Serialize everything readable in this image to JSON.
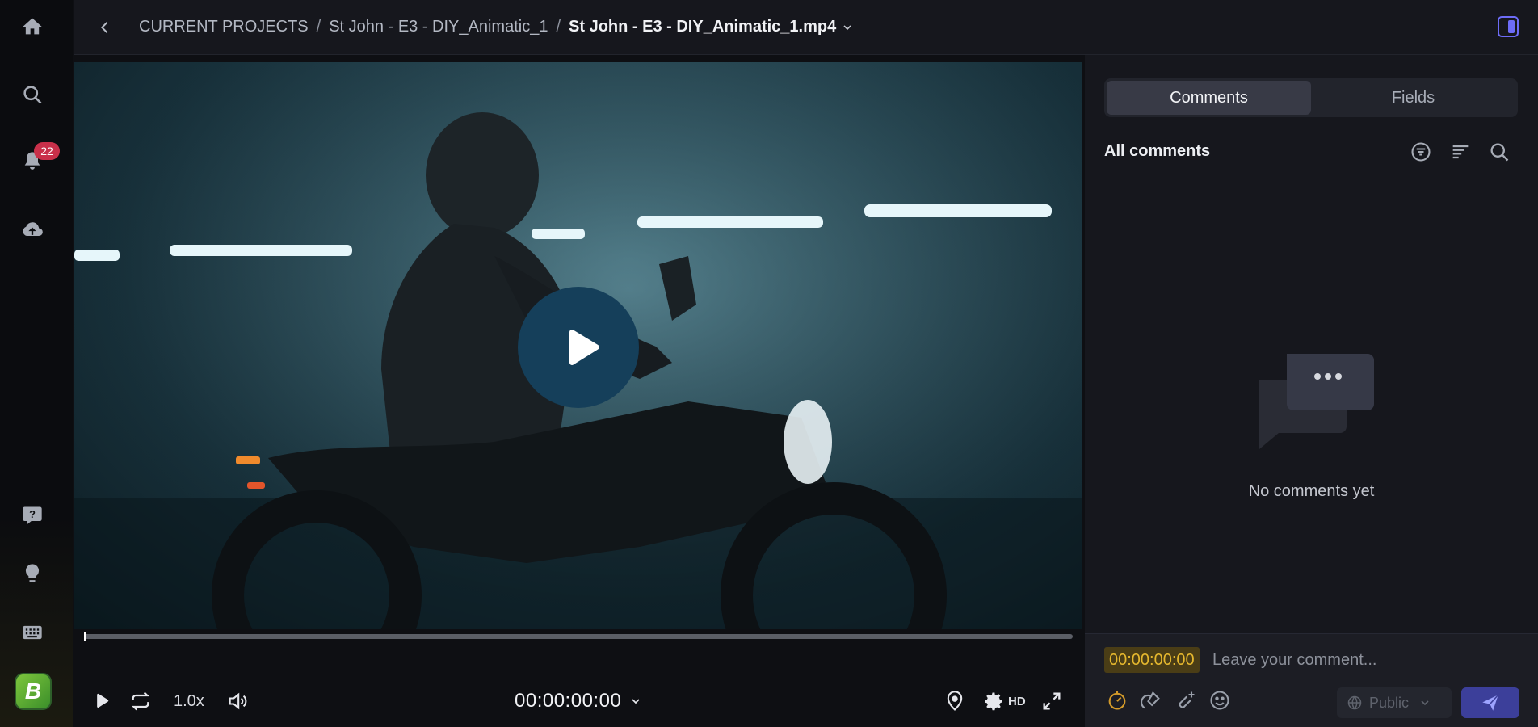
{
  "rail": {
    "notification_count": "22",
    "logo_letter": "B"
  },
  "header": {
    "breadcrumb": [
      "CURRENT PROJECTS",
      "St John - E3 - DIY_Animatic_1",
      "St John - E3 - DIY_Animatic_1.mp4"
    ],
    "separator": "/"
  },
  "player": {
    "progress": 0.0,
    "playback_rate": "1.0x",
    "timecode": "00:00:00:00",
    "quality": "HD"
  },
  "panel": {
    "tabs": [
      {
        "label": "Comments",
        "active": true
      },
      {
        "label": "Fields",
        "active": false
      }
    ],
    "section_title": "All comments",
    "empty_message": "No comments yet"
  },
  "composer": {
    "timecode": "00:00:00:00",
    "placeholder": "Leave your comment...",
    "visibility": "Public"
  },
  "colors": {
    "accent": "#6d6cf7",
    "timecode_highlight": "#e6b82e",
    "badge": "#c9304a",
    "send_button": "#3c3f9a"
  }
}
